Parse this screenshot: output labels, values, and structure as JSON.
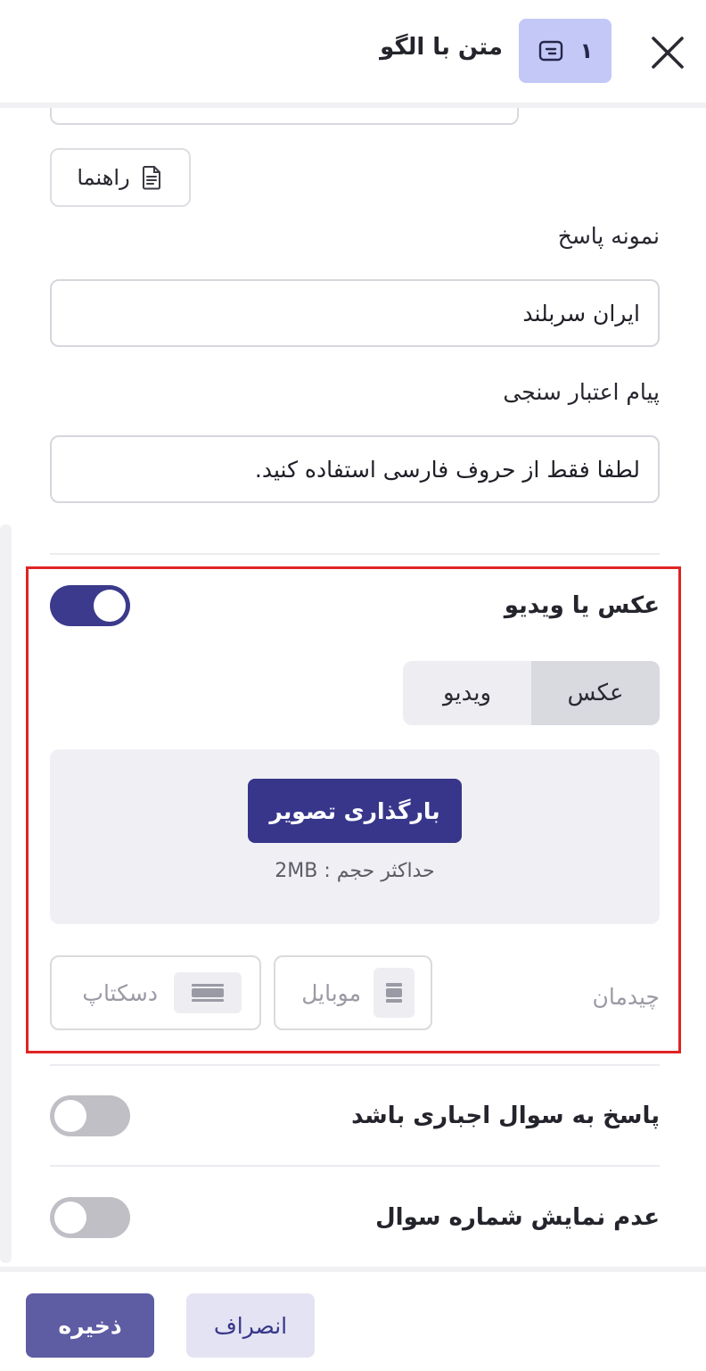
{
  "header": {
    "title": "متن با الگو",
    "question_number": "۱",
    "close_icon": "close-icon",
    "type_icon": "text-pattern-icon"
  },
  "guide": {
    "label": "راهنما",
    "icon": "document-icon"
  },
  "sample_answer": {
    "label": "نمونه پاسخ",
    "value": "ایران سربلند"
  },
  "validation_message": {
    "label": "پیام اعتبار سنجی",
    "value": "لطفا فقط از حروف فارسی استفاده کنید."
  },
  "media": {
    "title": "عکس یا ویدیو",
    "enabled": true,
    "tabs": [
      {
        "label": "عکس",
        "active": true
      },
      {
        "label": "ویدیو",
        "active": false
      }
    ],
    "upload_button": "بارگذاری تصویر",
    "upload_hint": "حداکثر حجم : 2MB",
    "layout_label": "چیدمان",
    "layout_options": [
      {
        "label": "موبایل",
        "icon": "mobile-layout-icon"
      },
      {
        "label": "دسکتاپ",
        "icon": "desktop-layout-icon"
      }
    ]
  },
  "settings": {
    "required": {
      "label": "پاسخ به سوال اجباری باشد",
      "enabled": false
    },
    "hide_number": {
      "label": "عدم نمایش شماره سوال",
      "enabled": false
    }
  },
  "footer": {
    "save": "ذخیره",
    "cancel": "انصراف"
  },
  "colors": {
    "primary": "#37368a",
    "badge": "#c3c8f7",
    "highlight": "#e02424"
  }
}
